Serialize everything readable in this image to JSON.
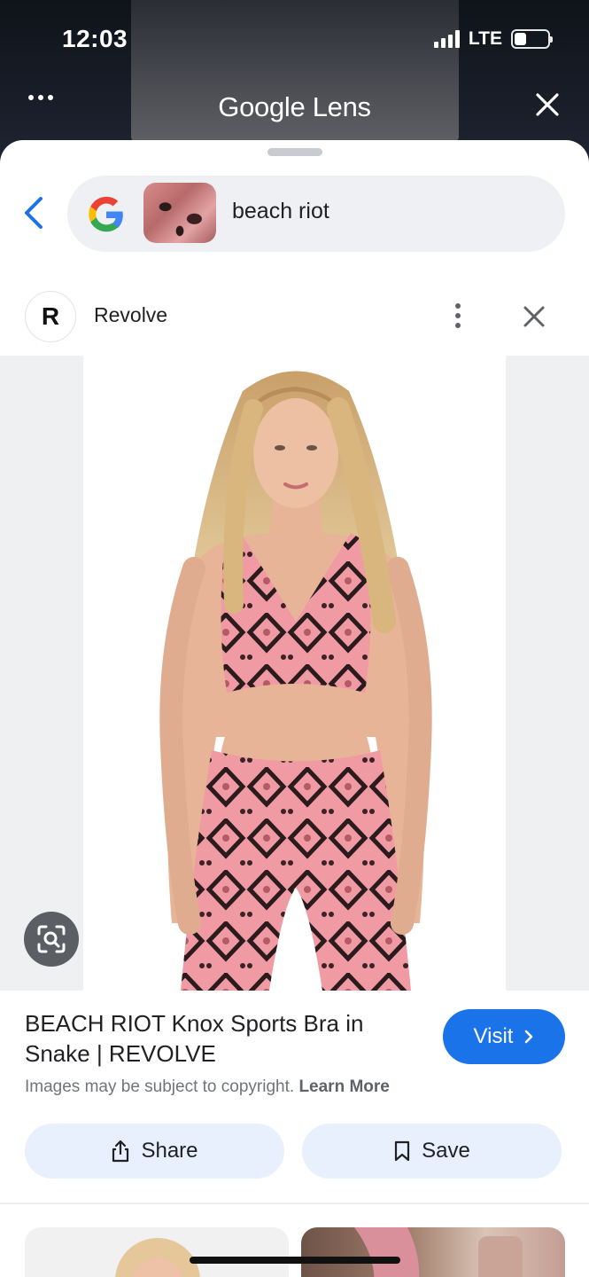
{
  "status_bar": {
    "time": "12:03",
    "network": "LTE",
    "battery_level": 0.35
  },
  "lens_header": {
    "title": "Google Lens",
    "menu_icon": "more-horizontal-icon",
    "close_icon": "close-icon"
  },
  "search": {
    "query": "beach riot",
    "logo_icon": "google-g-icon",
    "back_icon": "chevron-left-icon"
  },
  "result": {
    "source_initial": "R",
    "source_name": "Revolve",
    "title": "BEACH RIOT Knox Sports Bra in Snake | REVOLVE",
    "visit_label": "Visit",
    "copyright_text": "Images may be subject to copyright.",
    "learn_more": "Learn More",
    "share_label": "Share",
    "save_label": "Save"
  },
  "colors": {
    "accent": "#1a73e8",
    "pill_bg": "#e8f0fe",
    "product_pink": "#e9909a"
  }
}
